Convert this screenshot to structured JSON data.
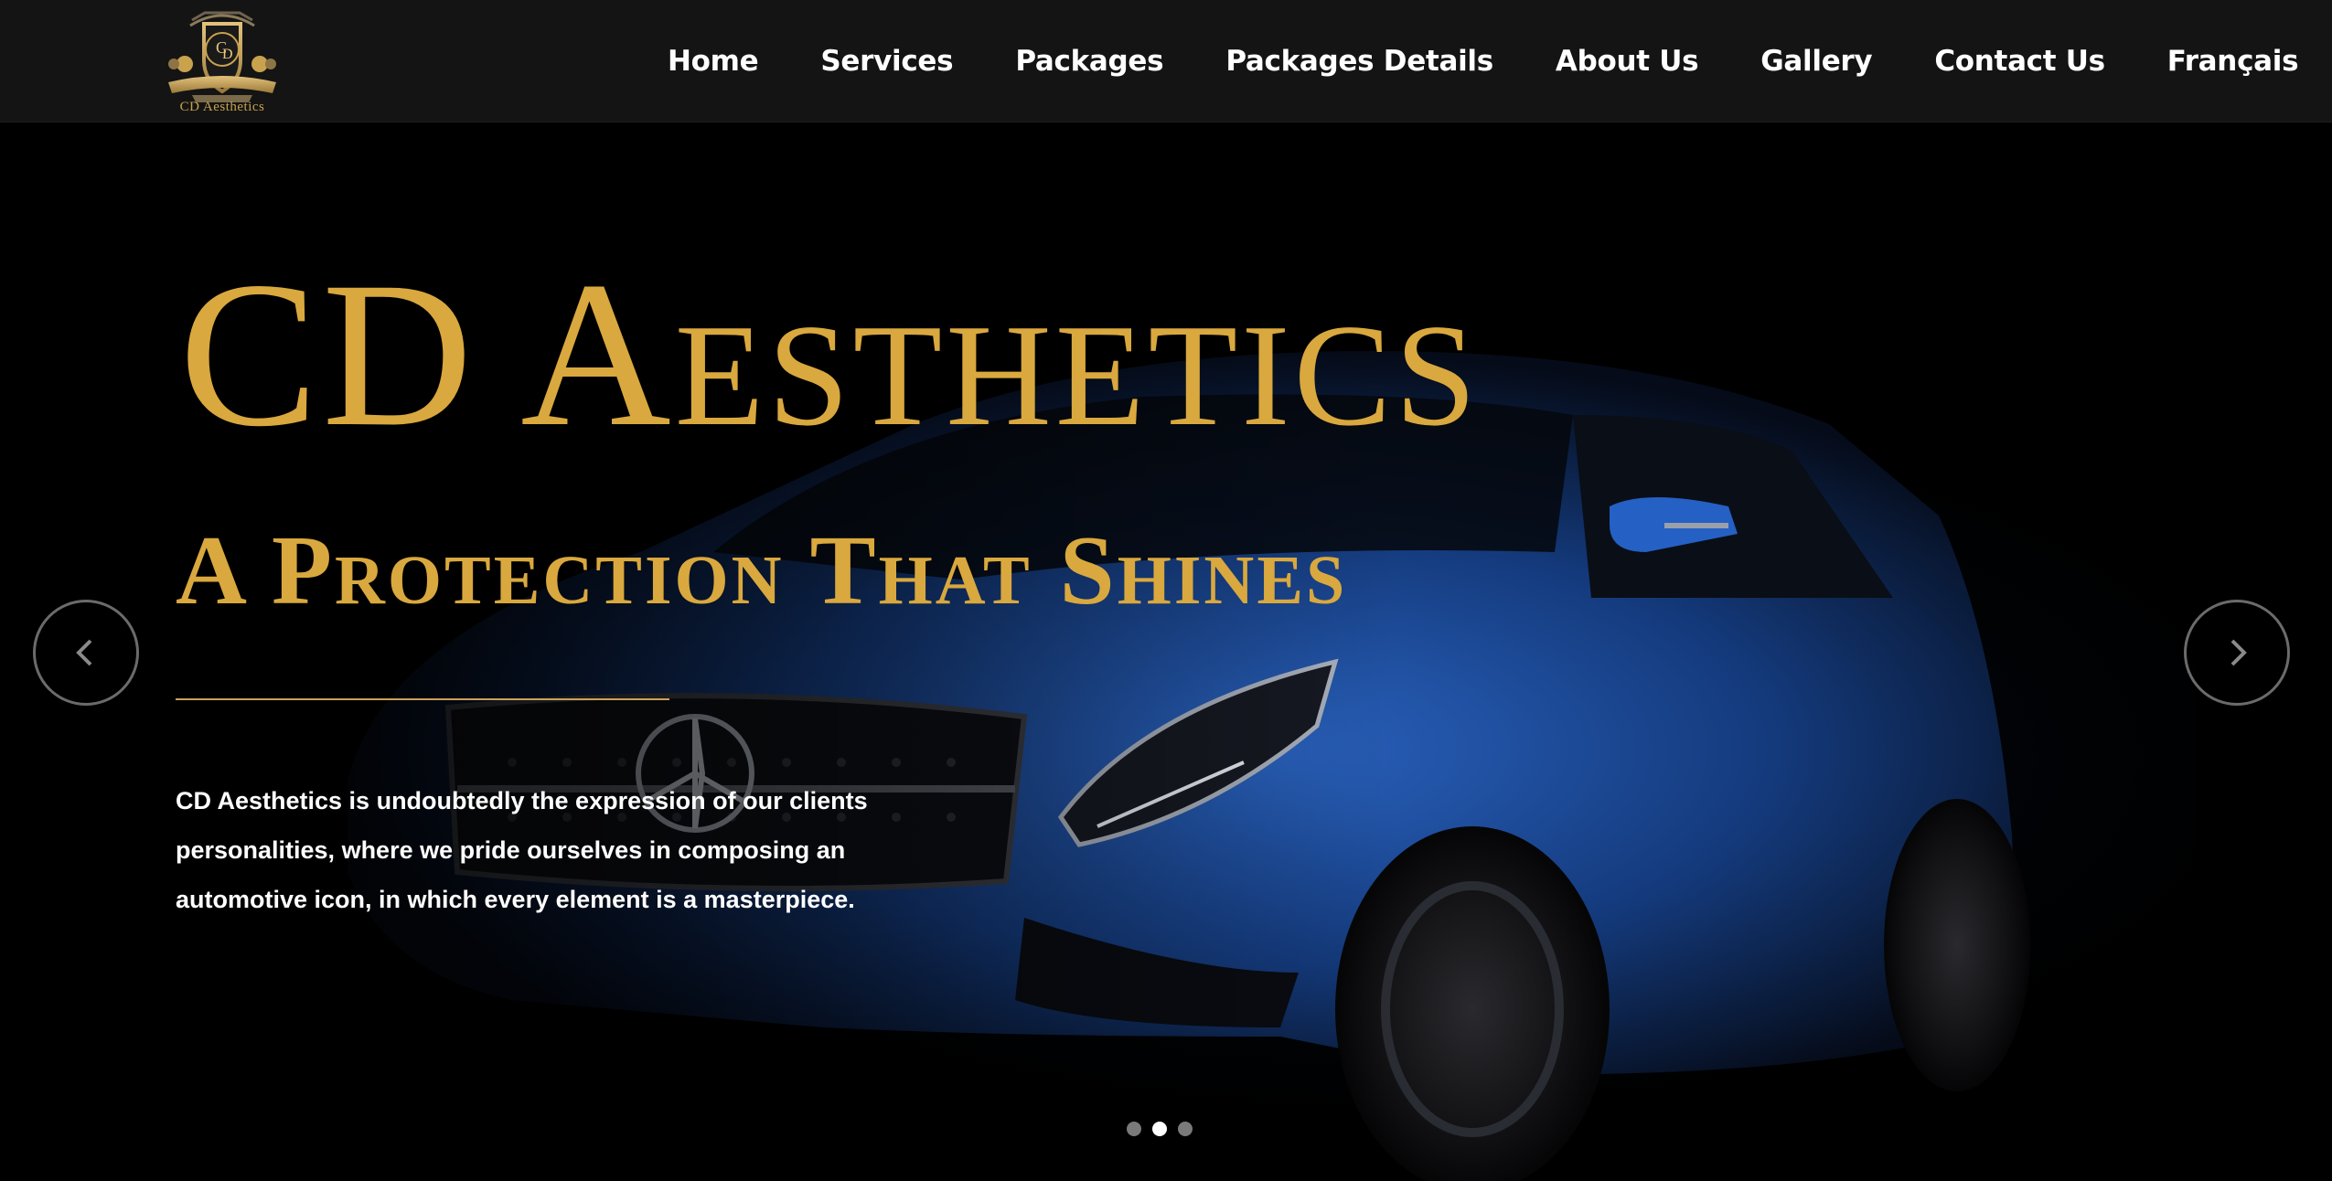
{
  "header": {
    "logo_text": "CD Aesthetics",
    "logo_initials": "CD",
    "nav": [
      {
        "label": "Home"
      },
      {
        "label": "Services"
      },
      {
        "label": "Packages"
      },
      {
        "label": "Packages Details"
      },
      {
        "label": "About Us"
      },
      {
        "label": "Gallery"
      },
      {
        "label": "Contact Us"
      },
      {
        "label": "Français"
      }
    ]
  },
  "hero": {
    "title": "CD Aesthetics",
    "subtitle": "A Protection That Shines",
    "description": "CD Aesthetics is undoubtedly the expression of our clients personalities, where we pride ourselves in composing an automotive icon, in which every element is a masterpiece.",
    "prev_icon": "chevron-left-icon",
    "next_icon": "chevron-right-icon",
    "slides": {
      "count": 3,
      "active": 2
    }
  },
  "colors": {
    "accent_gold": "#d9a83e",
    "header_bg": "#141414",
    "car_blue": "#1f4fa0"
  }
}
